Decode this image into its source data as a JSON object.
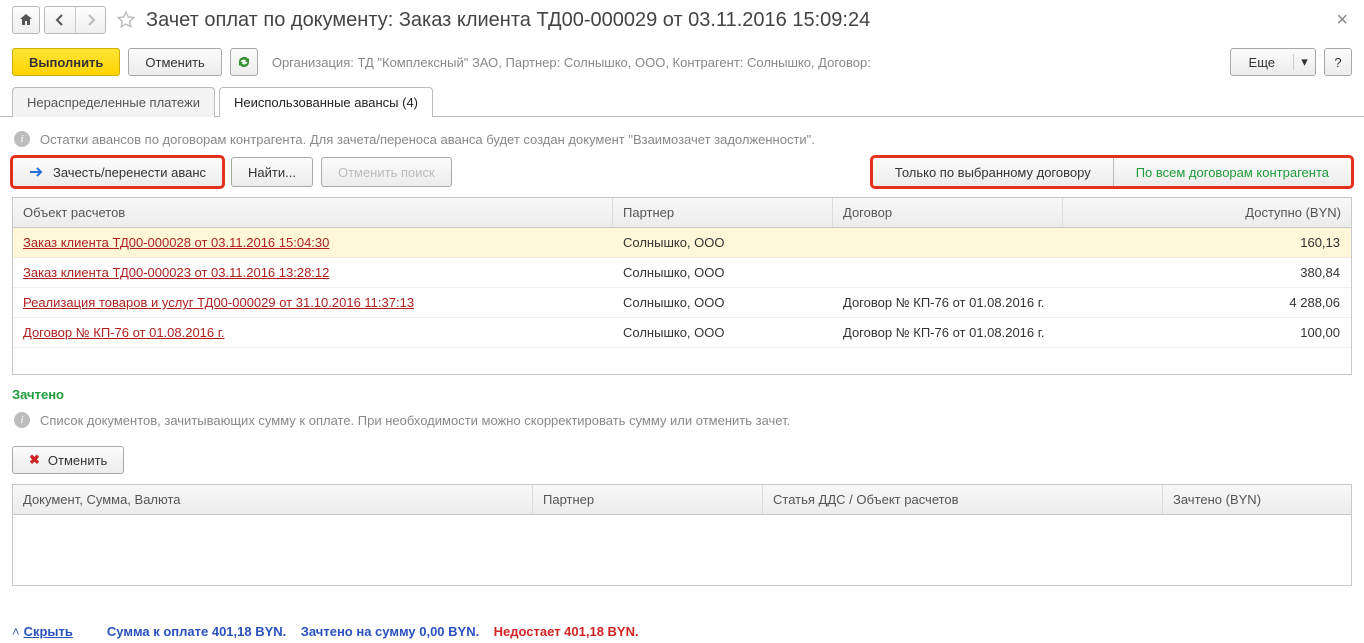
{
  "header": {
    "title": "Зачет оплат по документу: Заказ клиента ТД00-000029 от 03.11.2016 15:09:24"
  },
  "cmd": {
    "execute": "Выполнить",
    "cancel": "Отменить",
    "org_line": "Организация: ТД \"Комплексный\" ЗАО, Партнер: Солнышко, ООО, Контрагент: Солнышко, Договор:",
    "more": "Еще",
    "help": "?"
  },
  "tabs": {
    "t1": "Нераспределенные платежи",
    "t2": "Неиспользованные авансы (4)"
  },
  "panel": {
    "hint": "Остатки авансов по договорам контрагента. Для зачета/переноса аванса будет создан документ \"Взаимозачет задолженности\".",
    "btn_transfer": "Зачесть/перенести аванс",
    "btn_find": "Найти...",
    "btn_cancel_find": "Отменить поиск",
    "seg_selected": "Только по выбранному договору",
    "seg_all": "По всем договорам контрагента"
  },
  "grid_head": {
    "obj": "Объект расчетов",
    "partner": "Партнер",
    "contract": "Договор",
    "avail": "Доступно (BYN)"
  },
  "rows": [
    {
      "obj": "Заказ клиента ТД00-000028 от 03.11.2016 15:04:30",
      "partner": "Солнышко, ООО",
      "contract": "",
      "avail": "160,13"
    },
    {
      "obj": "Заказ клиента ТД00-000023 от 03.11.2016 13:28:12",
      "partner": "Солнышко, ООО",
      "contract": "",
      "avail": "380,84"
    },
    {
      "obj": "Реализация товаров и услуг ТД00-000029 от 31.10.2016 11:37:13",
      "partner": "Солнышко, ООО",
      "contract": "Договор № КП-76 от 01.08.2016 г.",
      "avail": "4 288,06"
    },
    {
      "obj": "Договор № КП-76 от 01.08.2016 г.",
      "partner": "Солнышко, ООО",
      "contract": "Договор № КП-76 от 01.08.2016 г.",
      "avail": "100,00"
    }
  ],
  "lower": {
    "title": "Зачтено",
    "hint": "Список документов, зачитывающих сумму к оплате. При необходимости можно скорректировать сумму или отменить зачет.",
    "btn_cancel": "Отменить"
  },
  "grid2_head": {
    "doc": "Документ, Сумма, Валюта",
    "partner": "Партнер",
    "dds": "Статья ДДС / Объект расчетов",
    "zach": "Зачтено (BYN)"
  },
  "footer": {
    "hide": "Скрыть",
    "sum_pay": "Сумма к оплате 401,18 BYN.",
    "sum_zach": "Зачтено на сумму 0,00 BYN.",
    "short": "Недостает 401,18 BYN."
  }
}
